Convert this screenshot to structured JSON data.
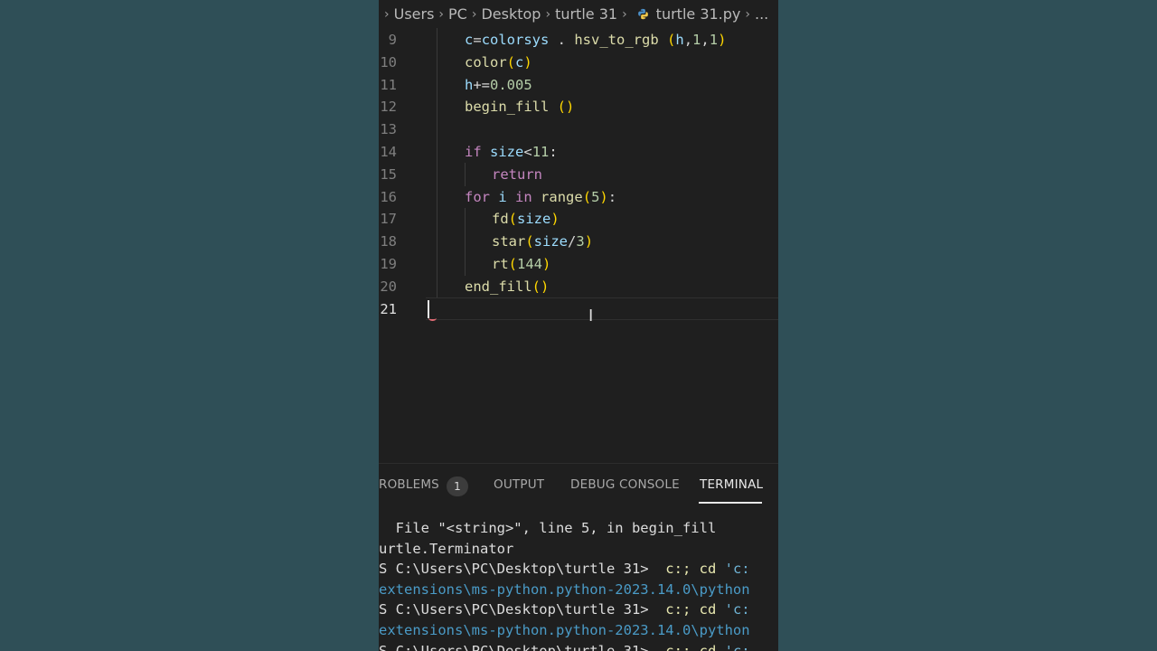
{
  "breadcrumb": {
    "items": [
      "Users",
      "PC",
      "Desktop",
      "turtle 31",
      "turtle 31.py"
    ],
    "leading_separator": "›",
    "separator": "›",
    "overflow": "...",
    "file_icon": "python-icon"
  },
  "editor": {
    "lines": [
      {
        "num": "9",
        "tokens": [
          [
            "var",
            "c"
          ],
          [
            "",
            "="
          ],
          [
            "var",
            "colorsys"
          ],
          [
            "",
            " . "
          ],
          [
            "fn",
            "hsv_to_rgb"
          ],
          [
            "",
            " "
          ],
          [
            "pa",
            "("
          ],
          [
            "var",
            "h"
          ],
          [
            "",
            ","
          ],
          [
            "num",
            "1"
          ],
          [
            "",
            ","
          ],
          [
            "num",
            "1"
          ],
          [
            "pa",
            ")"
          ]
        ]
      },
      {
        "num": "10",
        "tokens": [
          [
            "fn",
            "color"
          ],
          [
            "pa",
            "("
          ],
          [
            "var",
            "c"
          ],
          [
            "pa",
            ")"
          ]
        ]
      },
      {
        "num": "11",
        "tokens": [
          [
            "var",
            "h"
          ],
          [
            "",
            "+="
          ],
          [
            "num",
            "0.005"
          ]
        ]
      },
      {
        "num": "12",
        "tokens": [
          [
            "fn",
            "begin_fill"
          ],
          [
            "",
            " "
          ],
          [
            "pa",
            "()"
          ]
        ]
      },
      {
        "num": "13",
        "tokens": []
      },
      {
        "num": "14",
        "tokens": [
          [
            "kw",
            "if"
          ],
          [
            "",
            " "
          ],
          [
            "var",
            "size"
          ],
          [
            "",
            "<"
          ],
          [
            "num",
            "11"
          ],
          [
            "",
            ":"
          ]
        ]
      },
      {
        "num": "15",
        "tokens": [
          [
            "kw",
            "return"
          ]
        ]
      },
      {
        "num": "16",
        "tokens": [
          [
            "kw",
            "for"
          ],
          [
            "",
            " "
          ],
          [
            "var",
            "i"
          ],
          [
            "",
            " "
          ],
          [
            "kw",
            "in"
          ],
          [
            "",
            " "
          ],
          [
            "fn",
            "range"
          ],
          [
            "pa",
            "("
          ],
          [
            "num",
            "5"
          ],
          [
            "pa",
            ")"
          ],
          [
            "",
            ":"
          ]
        ]
      },
      {
        "num": "17",
        "tokens": [
          [
            "fn",
            "fd"
          ],
          [
            "pa",
            "("
          ],
          [
            "var",
            "size"
          ],
          [
            "pa",
            ")"
          ]
        ]
      },
      {
        "num": "18",
        "tokens": [
          [
            "fn",
            "star"
          ],
          [
            "pa",
            "("
          ],
          [
            "var",
            "size"
          ],
          [
            "",
            "/"
          ],
          [
            "num",
            "3"
          ],
          [
            "pa",
            ")"
          ]
        ]
      },
      {
        "num": "19",
        "tokens": [
          [
            "fn",
            "rt"
          ],
          [
            "pa",
            "("
          ],
          [
            "num",
            "144"
          ],
          [
            "pa",
            ")"
          ]
        ]
      },
      {
        "num": "20",
        "tokens": [
          [
            "fn",
            "end_fill"
          ],
          [
            "pa",
            "()"
          ]
        ]
      },
      {
        "num": "21",
        "tokens": []
      }
    ],
    "current_line": "21"
  },
  "panel": {
    "tabs": [
      {
        "label": "ROBLEMS",
        "badge": "1"
      },
      {
        "label": "OUTPUT"
      },
      {
        "label": "DEBUG CONSOLE"
      },
      {
        "label": "TERMINAL",
        "active": true
      }
    ],
    "terminal_lines": [
      {
        "text": "  File \"<string>\", line 5, in begin_fill"
      },
      {
        "text": "urtle.Terminator"
      },
      {
        "prompt": "S C:\\Users\\PC\\Desktop\\turtle 31> ",
        "cmd": " c:; cd ",
        "str": "'c:"
      },
      {
        "text": "extensions\\ms-python.python-2023.14.0\\python",
        "link": true
      },
      {
        "prompt": "S C:\\Users\\PC\\Desktop\\turtle 31> ",
        "cmd": " c:; cd ",
        "str": "'c:"
      },
      {
        "text": "extensions\\ms-python.python-2023.14.0\\python",
        "link": true
      },
      {
        "prompt": "S C:\\Users\\PC\\Desktop\\turtle 31> ",
        "cmd": " c:; cd ",
        "str": "'c:"
      }
    ]
  },
  "colors": {
    "background_blur": "#2f4f57",
    "editor_bg": "#1f1f1f",
    "keyword": "#c586c0",
    "function": "#dcdcaa",
    "variable": "#9cdcfe",
    "number": "#b5cea8",
    "bracket": "#ffd700"
  }
}
